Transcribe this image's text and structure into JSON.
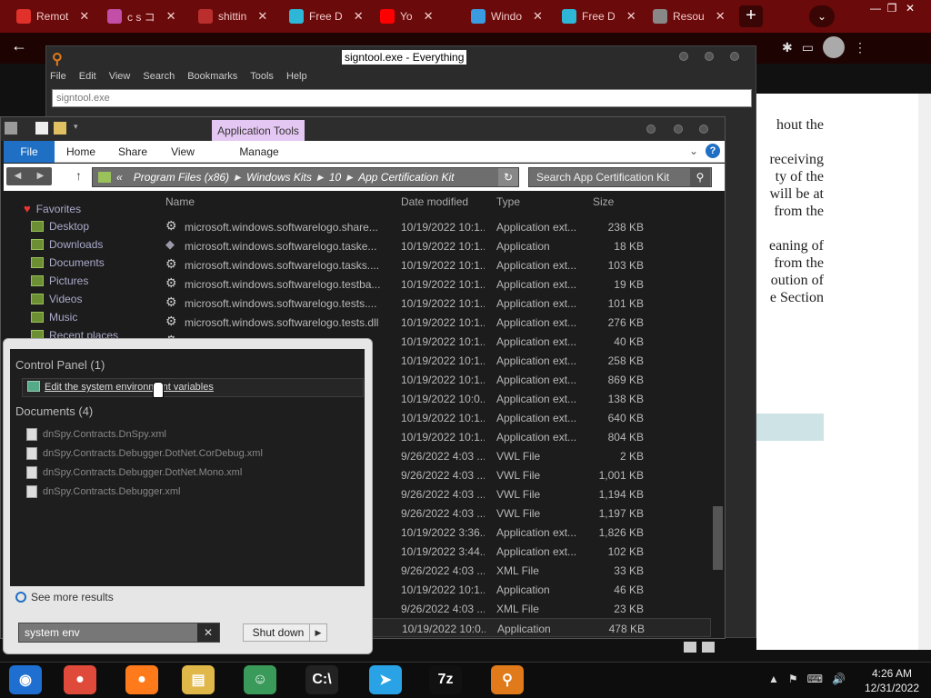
{
  "browser": {
    "tabs": [
      {
        "label": "Remot",
        "color": "#e0312b"
      },
      {
        "label": "c s コ",
        "color": "#c24ea8"
      },
      {
        "label": "shittin",
        "color": "#bb2e2e"
      },
      {
        "label": "Free D",
        "color": "#2db6d6"
      },
      {
        "label": "Yo",
        "color": "#ff0000"
      },
      {
        "label": "Windo",
        "color": "#3b9be0"
      },
      {
        "label": "Free D",
        "color": "#2db6d6"
      },
      {
        "label": "Resou",
        "color": "#888888"
      }
    ],
    "new_tab": "+",
    "menu": "⌄",
    "controls": {
      "minimize": "—",
      "restore": "❐",
      "close": "✕"
    }
  },
  "webpage": {
    "lines": [
      "hout the",
      "",
      "receiving",
      "ty of the",
      "will be at",
      "from the",
      "",
      "eaning of",
      "from the",
      "oution of",
      "e Section"
    ]
  },
  "everything": {
    "title": "signtool.exe - Everything",
    "menu": [
      "File",
      "Edit",
      "View",
      "Search",
      "Bookmarks",
      "Tools",
      "Help"
    ],
    "search_value": "signtool.exe"
  },
  "explorer": {
    "context_tab": "Application Tools",
    "ribbon_tabs": [
      "File",
      "Home",
      "Share",
      "View",
      "Manage"
    ],
    "breadcrumb": [
      "Program Files (x86)",
      "Windows Kits",
      "10",
      "App Certification Kit"
    ],
    "breadcrumb_prefix": "«",
    "search_placeholder": "Search App Certification Kit",
    "nav": [
      {
        "label": "Favorites"
      },
      {
        "label": "Desktop"
      },
      {
        "label": "Downloads"
      },
      {
        "label": "Documents"
      },
      {
        "label": "Pictures"
      },
      {
        "label": "Videos"
      },
      {
        "label": "Music"
      },
      {
        "label": "Recent places"
      }
    ],
    "columns": {
      "name": "Name",
      "date": "Date modified",
      "type": "Type",
      "size": "Size"
    },
    "files": [
      {
        "name": "microsoft.windows.softwarelogo.share...",
        "date": "10/19/2022 10:1...",
        "type": "Application ext...",
        "size": "238 KB",
        "icon": "gear"
      },
      {
        "name": "microsoft.windows.softwarelogo.taske...",
        "date": "10/19/2022 10:1...",
        "type": "Application",
        "size": "18 KB",
        "icon": "app"
      },
      {
        "name": "microsoft.windows.softwarelogo.tasks....",
        "date": "10/19/2022 10:1...",
        "type": "Application ext...",
        "size": "103 KB",
        "icon": "gear"
      },
      {
        "name": "microsoft.windows.softwarelogo.testba...",
        "date": "10/19/2022 10:1...",
        "type": "Application ext...",
        "size": "19 KB",
        "icon": "gear"
      },
      {
        "name": "microsoft.windows.softwarelogo.tests....",
        "date": "10/19/2022 10:1...",
        "type": "Application ext...",
        "size": "101 KB",
        "icon": "gear"
      },
      {
        "name": "microsoft.windows.softwarelogo.tests.dll",
        "date": "10/19/2022 10:1...",
        "type": "Application ext...",
        "size": "276 KB",
        "icon": "gear"
      },
      {
        "name": "",
        "date": "10/19/2022 10:1...",
        "type": "Application ext...",
        "size": "40 KB",
        "icon": "gear"
      },
      {
        "name": "",
        "date": "10/19/2022 10:1...",
        "type": "Application ext...",
        "size": "258 KB",
        "icon": "none"
      },
      {
        "name": "",
        "date": "10/19/2022 10:1...",
        "type": "Application ext...",
        "size": "869 KB",
        "icon": "none"
      },
      {
        "name": "",
        "date": "10/19/2022 10:0...",
        "type": "Application ext...",
        "size": "138 KB",
        "icon": "none"
      },
      {
        "name": "",
        "date": "10/19/2022 10:1...",
        "type": "Application ext...",
        "size": "640 KB",
        "icon": "none"
      },
      {
        "name": "",
        "date": "10/19/2022 10:1...",
        "type": "Application ext...",
        "size": "804 KB",
        "icon": "none"
      },
      {
        "name": "",
        "date": "9/26/2022 4:03 ...",
        "type": "VWL File",
        "size": "2 KB",
        "icon": "none"
      },
      {
        "name": "",
        "date": "9/26/2022 4:03 ...",
        "type": "VWL File",
        "size": "1,001 KB",
        "icon": "none"
      },
      {
        "name": "",
        "date": "9/26/2022 4:03 ...",
        "type": "VWL File",
        "size": "1,194 KB",
        "icon": "none"
      },
      {
        "name": "",
        "date": "9/26/2022 4:03 ...",
        "type": "VWL File",
        "size": "1,197 KB",
        "icon": "none"
      },
      {
        "name": "",
        "date": "10/19/2022 3:36...",
        "type": "Application ext...",
        "size": "1,826 KB",
        "icon": "none"
      },
      {
        "name": "",
        "date": "10/19/2022 3:44...",
        "type": "Application ext...",
        "size": "102 KB",
        "icon": "none"
      },
      {
        "name": "",
        "date": "9/26/2022 4:03 ...",
        "type": "XML File",
        "size": "33 KB",
        "icon": "none"
      },
      {
        "name": "",
        "date": "10/19/2022 10:1...",
        "type": "Application",
        "size": "46 KB",
        "icon": "none"
      },
      {
        "name": "",
        "date": "9/26/2022 4:03 ...",
        "type": "XML File",
        "size": "23 KB",
        "icon": "none"
      },
      {
        "name": "",
        "date": "10/19/2022 10:0...",
        "type": "Application",
        "size": "478 KB",
        "icon": "none"
      }
    ]
  },
  "startmenu": {
    "cp_heading": "Control Panel (1)",
    "cp_item": "Edit the system environment variables",
    "docs_heading": "Documents (4)",
    "docs": [
      "dnSpy.Contracts.DnSpy.xml",
      "dnSpy.Contracts.Debugger.DotNet.CorDebug.xml",
      "dnSpy.Contracts.Debugger.DotNet.Mono.xml",
      "dnSpy.Contracts.Debugger.xml"
    ],
    "see_more": "See more results",
    "search_value": "system env",
    "clear": "✕",
    "shutdown": "Shut down",
    "shutdown_arrow": "▶"
  },
  "taskbar": {
    "time": "4:26 AM",
    "date": "12/31/2022",
    "apps": [
      {
        "name": "app-icon",
        "glyph": "◉",
        "color": "#1e6fd0"
      },
      {
        "name": "chrome-icon",
        "glyph": "●",
        "color": "#e04a3a"
      },
      {
        "name": "firefox-icon",
        "glyph": "●",
        "color": "#ff7a1a"
      },
      {
        "name": "file-explorer-icon",
        "glyph": "▤",
        "color": "#e0b84a"
      },
      {
        "name": "users-icon",
        "glyph": "☺",
        "color": "#3a9a5a"
      },
      {
        "name": "terminal-icon",
        "glyph": "C:\\",
        "color": "#222222"
      },
      {
        "name": "send-icon",
        "glyph": "➤",
        "color": "#29a3e6"
      },
      {
        "name": "7zip-icon",
        "glyph": "7z",
        "color": "#111111"
      },
      {
        "name": "everything-icon",
        "glyph": "⚲",
        "color": "#e07a1a"
      }
    ],
    "tray": [
      "▲",
      "⚑",
      "⌨",
      "🔊"
    ]
  }
}
